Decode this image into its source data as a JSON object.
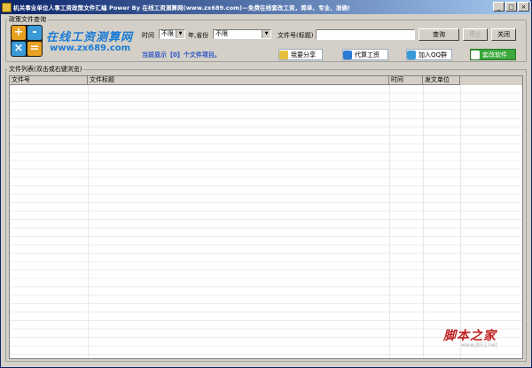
{
  "window": {
    "title": "机关事业单位人事工资政策文件汇编 Power By 在线工资测算网(www.zx689.com)—免费在线套改工资，简单、专业、准确!",
    "controls": {
      "minimize": "_",
      "maximize": "□",
      "close": "×"
    }
  },
  "query_group": {
    "label": "政策文件查询"
  },
  "logo": {
    "cn_text": "在线工资测算网",
    "url": "www.zx689.com",
    "symbols": [
      "+",
      "-",
      "×",
      "="
    ]
  },
  "filters": {
    "time_label": "时间",
    "time_value": "不限",
    "year_label": "年,省份",
    "province_value": "不限",
    "doc_label": "文件号(标题)",
    "doc_value": ""
  },
  "buttons": {
    "query": "查询",
    "stop": "停止",
    "close": "关闭"
  },
  "status": {
    "prefix": "当前显示【",
    "count": "0",
    "suffix": "】个文件项目。"
  },
  "feature_buttons": [
    {
      "label": "我要分享",
      "color": "#1a7bd4"
    },
    {
      "label": "代算工资",
      "color": "#1a7bd4"
    },
    {
      "label": "加入QQ群",
      "color": "#1a7bd4"
    },
    {
      "label": "套改软件",
      "color": "#3aa83a"
    }
  ],
  "list_group": {
    "label": "文件列表(双击或右键浏览)",
    "columns": [
      "文件号",
      "文件标题",
      "时间",
      "发文单位"
    ]
  },
  "watermark": {
    "text": "脚本之家",
    "url": "www.jb51.net"
  }
}
